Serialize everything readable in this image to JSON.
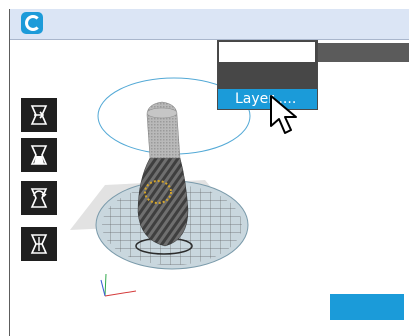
{
  "window": {
    "logo_icon": "app-logo-icon",
    "accent_color": "#1b9bd9"
  },
  "toolbar": {
    "tools": [
      {
        "name": "move-tool",
        "icon": "move-icon"
      },
      {
        "name": "scale-tool",
        "icon": "scale-icon"
      },
      {
        "name": "rotate-tool",
        "icon": "rotate-icon"
      },
      {
        "name": "mirror-tool",
        "icon": "mirror-icon"
      }
    ]
  },
  "context_menu": {
    "items": [
      {
        "label": "",
        "state": "blank"
      },
      {
        "label": "",
        "state": "dark"
      },
      {
        "label": "Layer ....",
        "state": "highlighted"
      }
    ]
  },
  "right_panel": {
    "header_label": "",
    "button_label": ""
  }
}
